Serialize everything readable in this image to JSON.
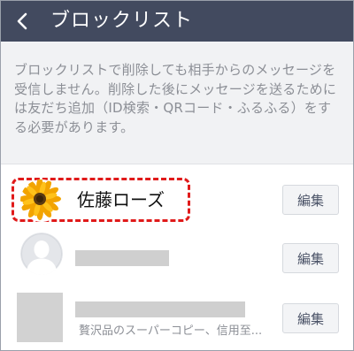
{
  "header": {
    "title": "ブロックリスト",
    "back_icon": "chevron-left-icon",
    "background_color": "#424a5f"
  },
  "notice": {
    "text": "ブロックリストで削除しても相手からのメッセージを受信しません。削除した後にメッセージを送るためには友だち追加（ID検索・QRコード・ふるふる）をする必要があります。"
  },
  "blocked_users": [
    {
      "name": "佐藤ローズ",
      "avatar": "sunflower-photo",
      "highlighted": true,
      "edit_label": "編集"
    },
    {
      "name": "",
      "avatar": "default-person-icon",
      "edit_label": "編集"
    },
    {
      "name": "",
      "status_message": "贅沢品のスーパーコピー、信用至...",
      "avatar": "redacted",
      "edit_label": "編集"
    }
  ],
  "colors": {
    "highlight_border": "#e01a1a",
    "notice_background": "#f1f2f4",
    "button_text": "#4c5468"
  }
}
